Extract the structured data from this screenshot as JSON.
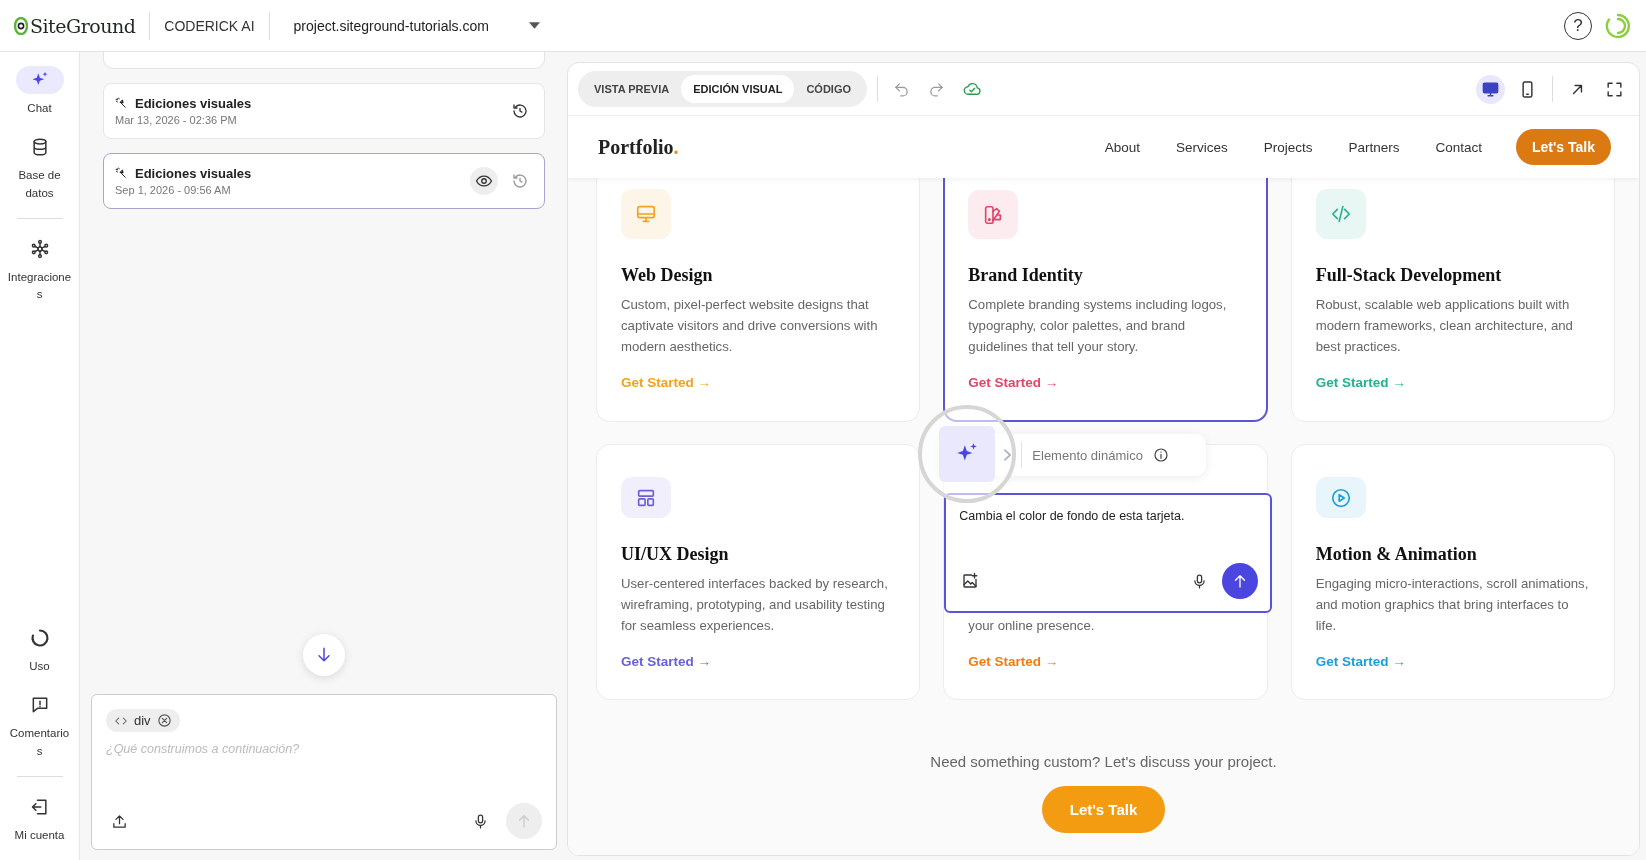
{
  "topbar": {
    "brand": "SiteGround",
    "product": "CODERICK AI",
    "site": "project.siteground-tutorials.com",
    "help": "?"
  },
  "nav": {
    "items": [
      {
        "label": "Chat",
        "selected": true
      },
      {
        "label": "Base de datos",
        "selected": false
      },
      {
        "label": "Integraciones",
        "selected": false
      }
    ],
    "bottom_items": [
      {
        "label": "Uso"
      },
      {
        "label": "Comentarios"
      },
      {
        "label": "Mi cuenta"
      }
    ]
  },
  "history": [
    {
      "title": "Ediciones visuales",
      "date": "Mar 13, 2026 - 02:36 PM",
      "selected": false
    },
    {
      "title": "Ediciones visuales",
      "date": "Sep 1, 2026 - 09:56 AM",
      "selected": true
    }
  ],
  "chat_input": {
    "chip": "div",
    "placeholder": "¿Qué construimos a continuación?",
    "send_disabled": true
  },
  "preview": {
    "tabs": [
      {
        "label": "VISTA PREVIA",
        "selected": false
      },
      {
        "label": "EDICIÓN VISUAL",
        "selected": true
      },
      {
        "label": "CÓDIGO",
        "selected": false
      }
    ],
    "devices": [
      {
        "kind": "desktop",
        "selected": true
      },
      {
        "kind": "mobile",
        "selected": false
      }
    ]
  },
  "site": {
    "logo": "Portfolio",
    "logo_dot": ".",
    "menu": [
      "About",
      "Services",
      "Projects",
      "Partners",
      "Contact"
    ],
    "cta": "Let's Talk",
    "cards": [
      {
        "title": "Web Design",
        "description": "Custom, pixel-perfect website designs that captivate visitors and drive conversions with modern aesthetics.",
        "link": "Get Started →",
        "color": "#f0a21e",
        "selected": false
      },
      {
        "title": "Brand Identity",
        "description": "Complete branding systems including logos, typography, color palettes, and brand guidelines that tell your story.",
        "link": "Get Started →",
        "color": "#e0456a",
        "selected": true
      },
      {
        "title": "Full-Stack Development",
        "description": "Robust, scalable web applications built with modern frameworks, clean architecture, and best practices.",
        "link": "Get Started →",
        "color": "#25b08f",
        "selected": false
      },
      {
        "title": "UI/UX Design",
        "description": "User-centered interfaces backed by research, wireframing, prototyping, and usability testing for seamless experiences.",
        "link": "Get Started →",
        "color": "#6a5fd8",
        "selected": false
      },
      {
        "description": "your online presence.",
        "link": "Get Started →",
        "color": "#ef7d12",
        "selected": false
      },
      {
        "title": "Motion & Animation",
        "description": "Engaging micro-interactions, scroll animations, and motion graphics that bring interfaces to life.",
        "link": "Get Started →",
        "color": "#1a9fd8",
        "selected": false
      }
    ],
    "footer_text": "Need something custom? Let's discuss your project.",
    "footer_cta": "Let's Talk"
  },
  "editor_popup": {
    "label": "Elemento dinámico",
    "prompt": "Cambia el color de fondo de esta tarjeta.",
    "send_disabled": false
  }
}
